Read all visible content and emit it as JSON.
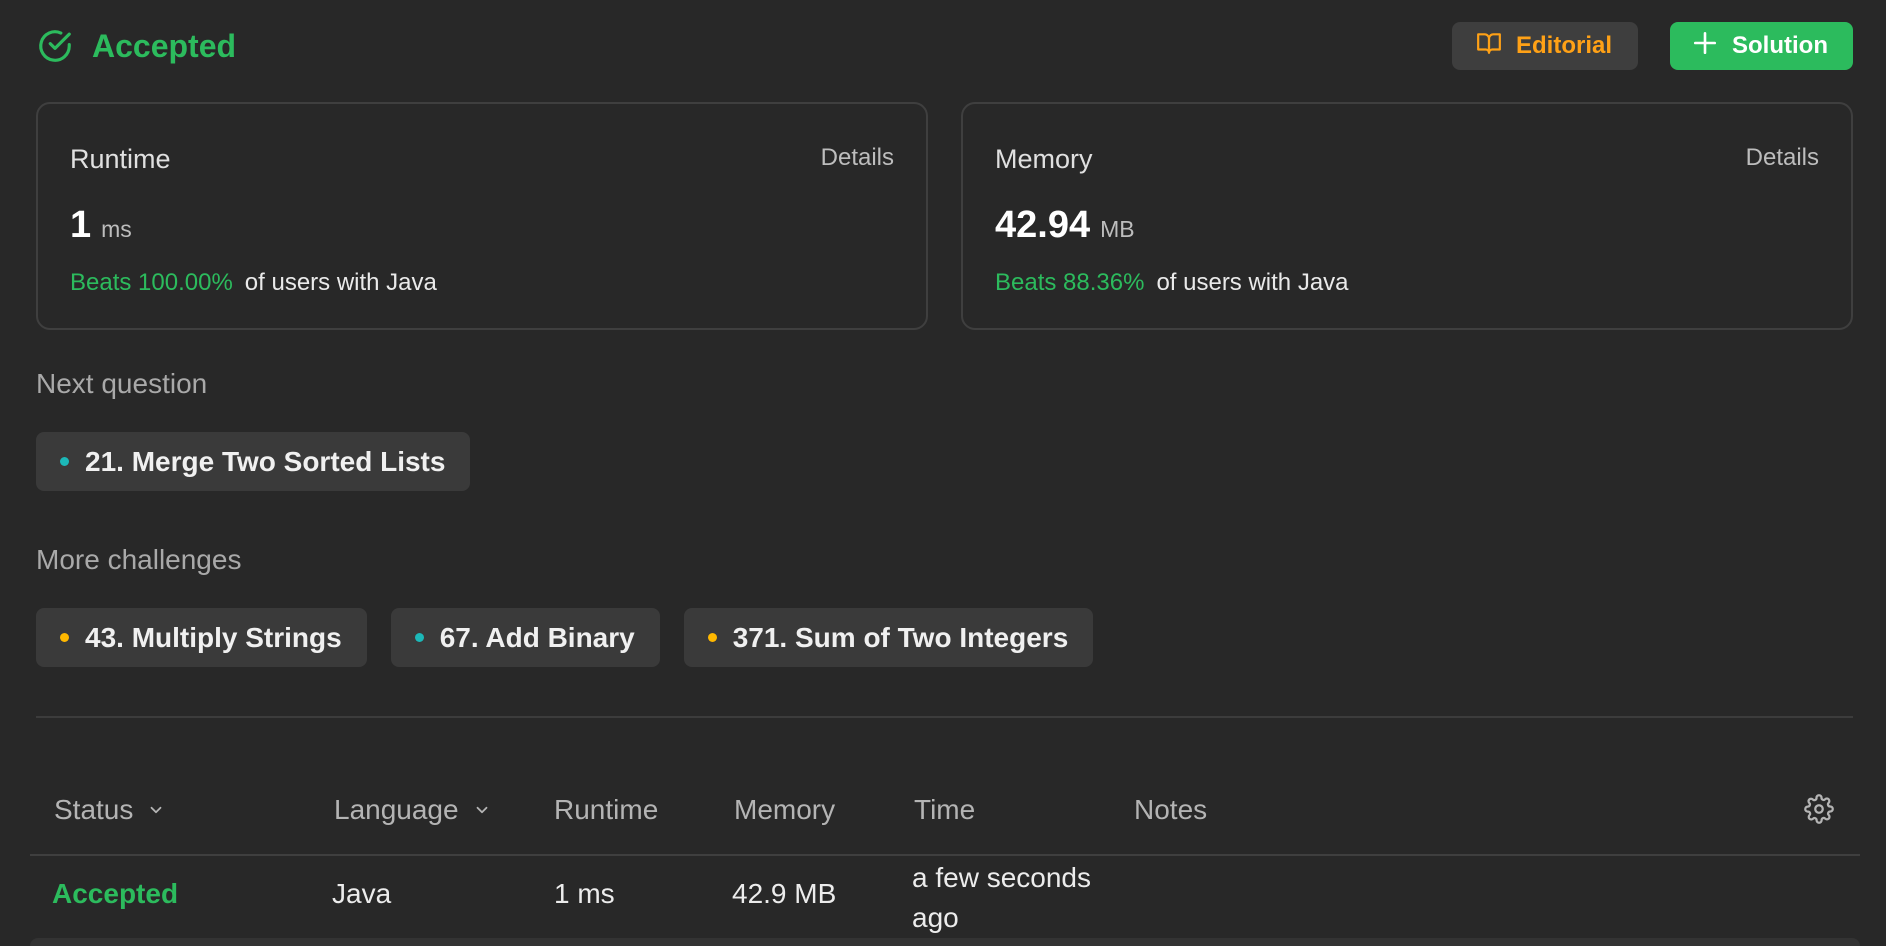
{
  "header": {
    "status": "Accepted",
    "editorial_label": "Editorial",
    "solution_label": "Solution"
  },
  "runtime_card": {
    "title": "Runtime",
    "details_label": "Details",
    "value": "1",
    "unit": "ms",
    "beats": "Beats 100.00%",
    "beats_suffix": "of users with Java"
  },
  "memory_card": {
    "title": "Memory",
    "details_label": "Details",
    "value": "42.94",
    "unit": "MB",
    "beats": "Beats 88.36%",
    "beats_suffix": "of users with Java"
  },
  "next_question": {
    "label": "Next question",
    "items": [
      {
        "title": "21. Merge Two Sorted Lists",
        "difficulty_color": "#1cb8b8"
      }
    ]
  },
  "more_challenges": {
    "label": "More challenges",
    "items": [
      {
        "title": "43. Multiply Strings",
        "difficulty_color": "#ffb800"
      },
      {
        "title": "67. Add Binary",
        "difficulty_color": "#1cb8b8"
      },
      {
        "title": "371. Sum of Two Integers",
        "difficulty_color": "#ffb800"
      }
    ]
  },
  "submissions": {
    "columns": [
      "Status",
      "Language",
      "Runtime",
      "Memory",
      "Time",
      "Notes"
    ],
    "rows": [
      {
        "status": "Accepted",
        "language": "Java",
        "runtime": "1 ms",
        "memory": "42.9 MB",
        "time_line1": "a few seconds",
        "time_line2": "ago",
        "notes": ""
      }
    ]
  },
  "colors": {
    "accent_green": "#2cbb5d",
    "accent_orange": "#ffa116",
    "easy": "#1cb8b8",
    "medium": "#ffb800",
    "background": "#282828"
  }
}
